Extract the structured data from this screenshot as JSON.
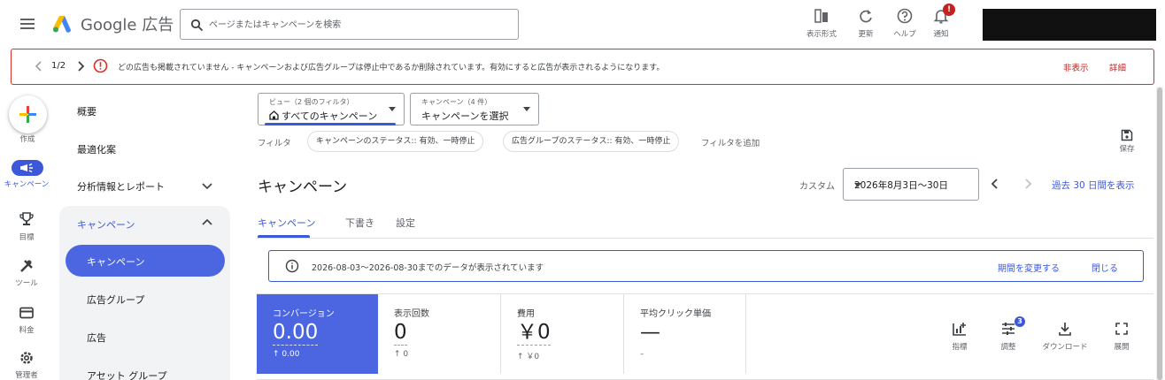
{
  "app": {
    "brand": "Google 広告",
    "search_placeholder": "ページまたはキャンペーンを検索"
  },
  "toolbar": {
    "view_mode": "表示形式",
    "refresh": "更新",
    "help": "ヘルプ",
    "notifications": "通知",
    "notifications_badge": "!"
  },
  "alert": {
    "page": "1/2",
    "message": "どの広告も掲載されていません - キャンペーンおよび広告グループは停止中であるか削除されています。有効にすると広告が表示されるようになります。",
    "hide": "非表示",
    "details": "詳細"
  },
  "rail": {
    "create": "作成",
    "campaigns": "キャンペーン",
    "goals": "目標",
    "tools": "ツール",
    "billing": "料金",
    "admin": "管理者"
  },
  "nav": {
    "overview": "概要",
    "recommendations": "最適化案",
    "insights_reports": "分析情報とレポート",
    "campaigns_section": "キャンペーン",
    "sub": [
      "キャンペーン",
      "広告グループ",
      "広告",
      "アセット グループ"
    ]
  },
  "filters": {
    "view_caption": "ビュー（2 個のフィルタ）",
    "view_value": "すべてのキャンペーン",
    "campaign_caption": "キャンペーン（4 件）",
    "campaign_value": "キャンペーンを選択",
    "filter_label": "フィルタ",
    "chips": [
      "キャンペーンのステータス:: 有効、一時停止",
      "広告グループのステータス:: 有効、一時停止"
    ],
    "add_filter": "フィルタを追加",
    "save": "保存"
  },
  "page": {
    "title": "キャンペーン",
    "custom": "カスタム",
    "date_range": "2026年8月3日〜30日",
    "last30": "過去 30 日間を表示"
  },
  "tabs": [
    "キャンペーン",
    "下書き",
    "設定"
  ],
  "info": {
    "message": "2026-08-03〜2026-08-30までのデータが表示されています",
    "change_period": "期間を変更する",
    "close": "閉じる"
  },
  "scorecards": [
    {
      "name": "コンバージョン",
      "value": "0.00",
      "delta": "↑ 0.00"
    },
    {
      "name": "表示回数",
      "value": "0",
      "delta": "↑ 0"
    },
    {
      "name": "費用",
      "value": "￥0",
      "delta": "↑ ￥0"
    },
    {
      "name": "平均クリック単価",
      "value": "—",
      "delta": "–"
    }
  ],
  "card_tools": {
    "metrics": "指標",
    "adjust": "調整",
    "adjust_badge": "3",
    "download": "ダウンロード",
    "expand": "展開"
  },
  "colors": {
    "accent": "#3c58d9",
    "accent_card": "#4c66e2",
    "alert_red": "#d93025"
  }
}
